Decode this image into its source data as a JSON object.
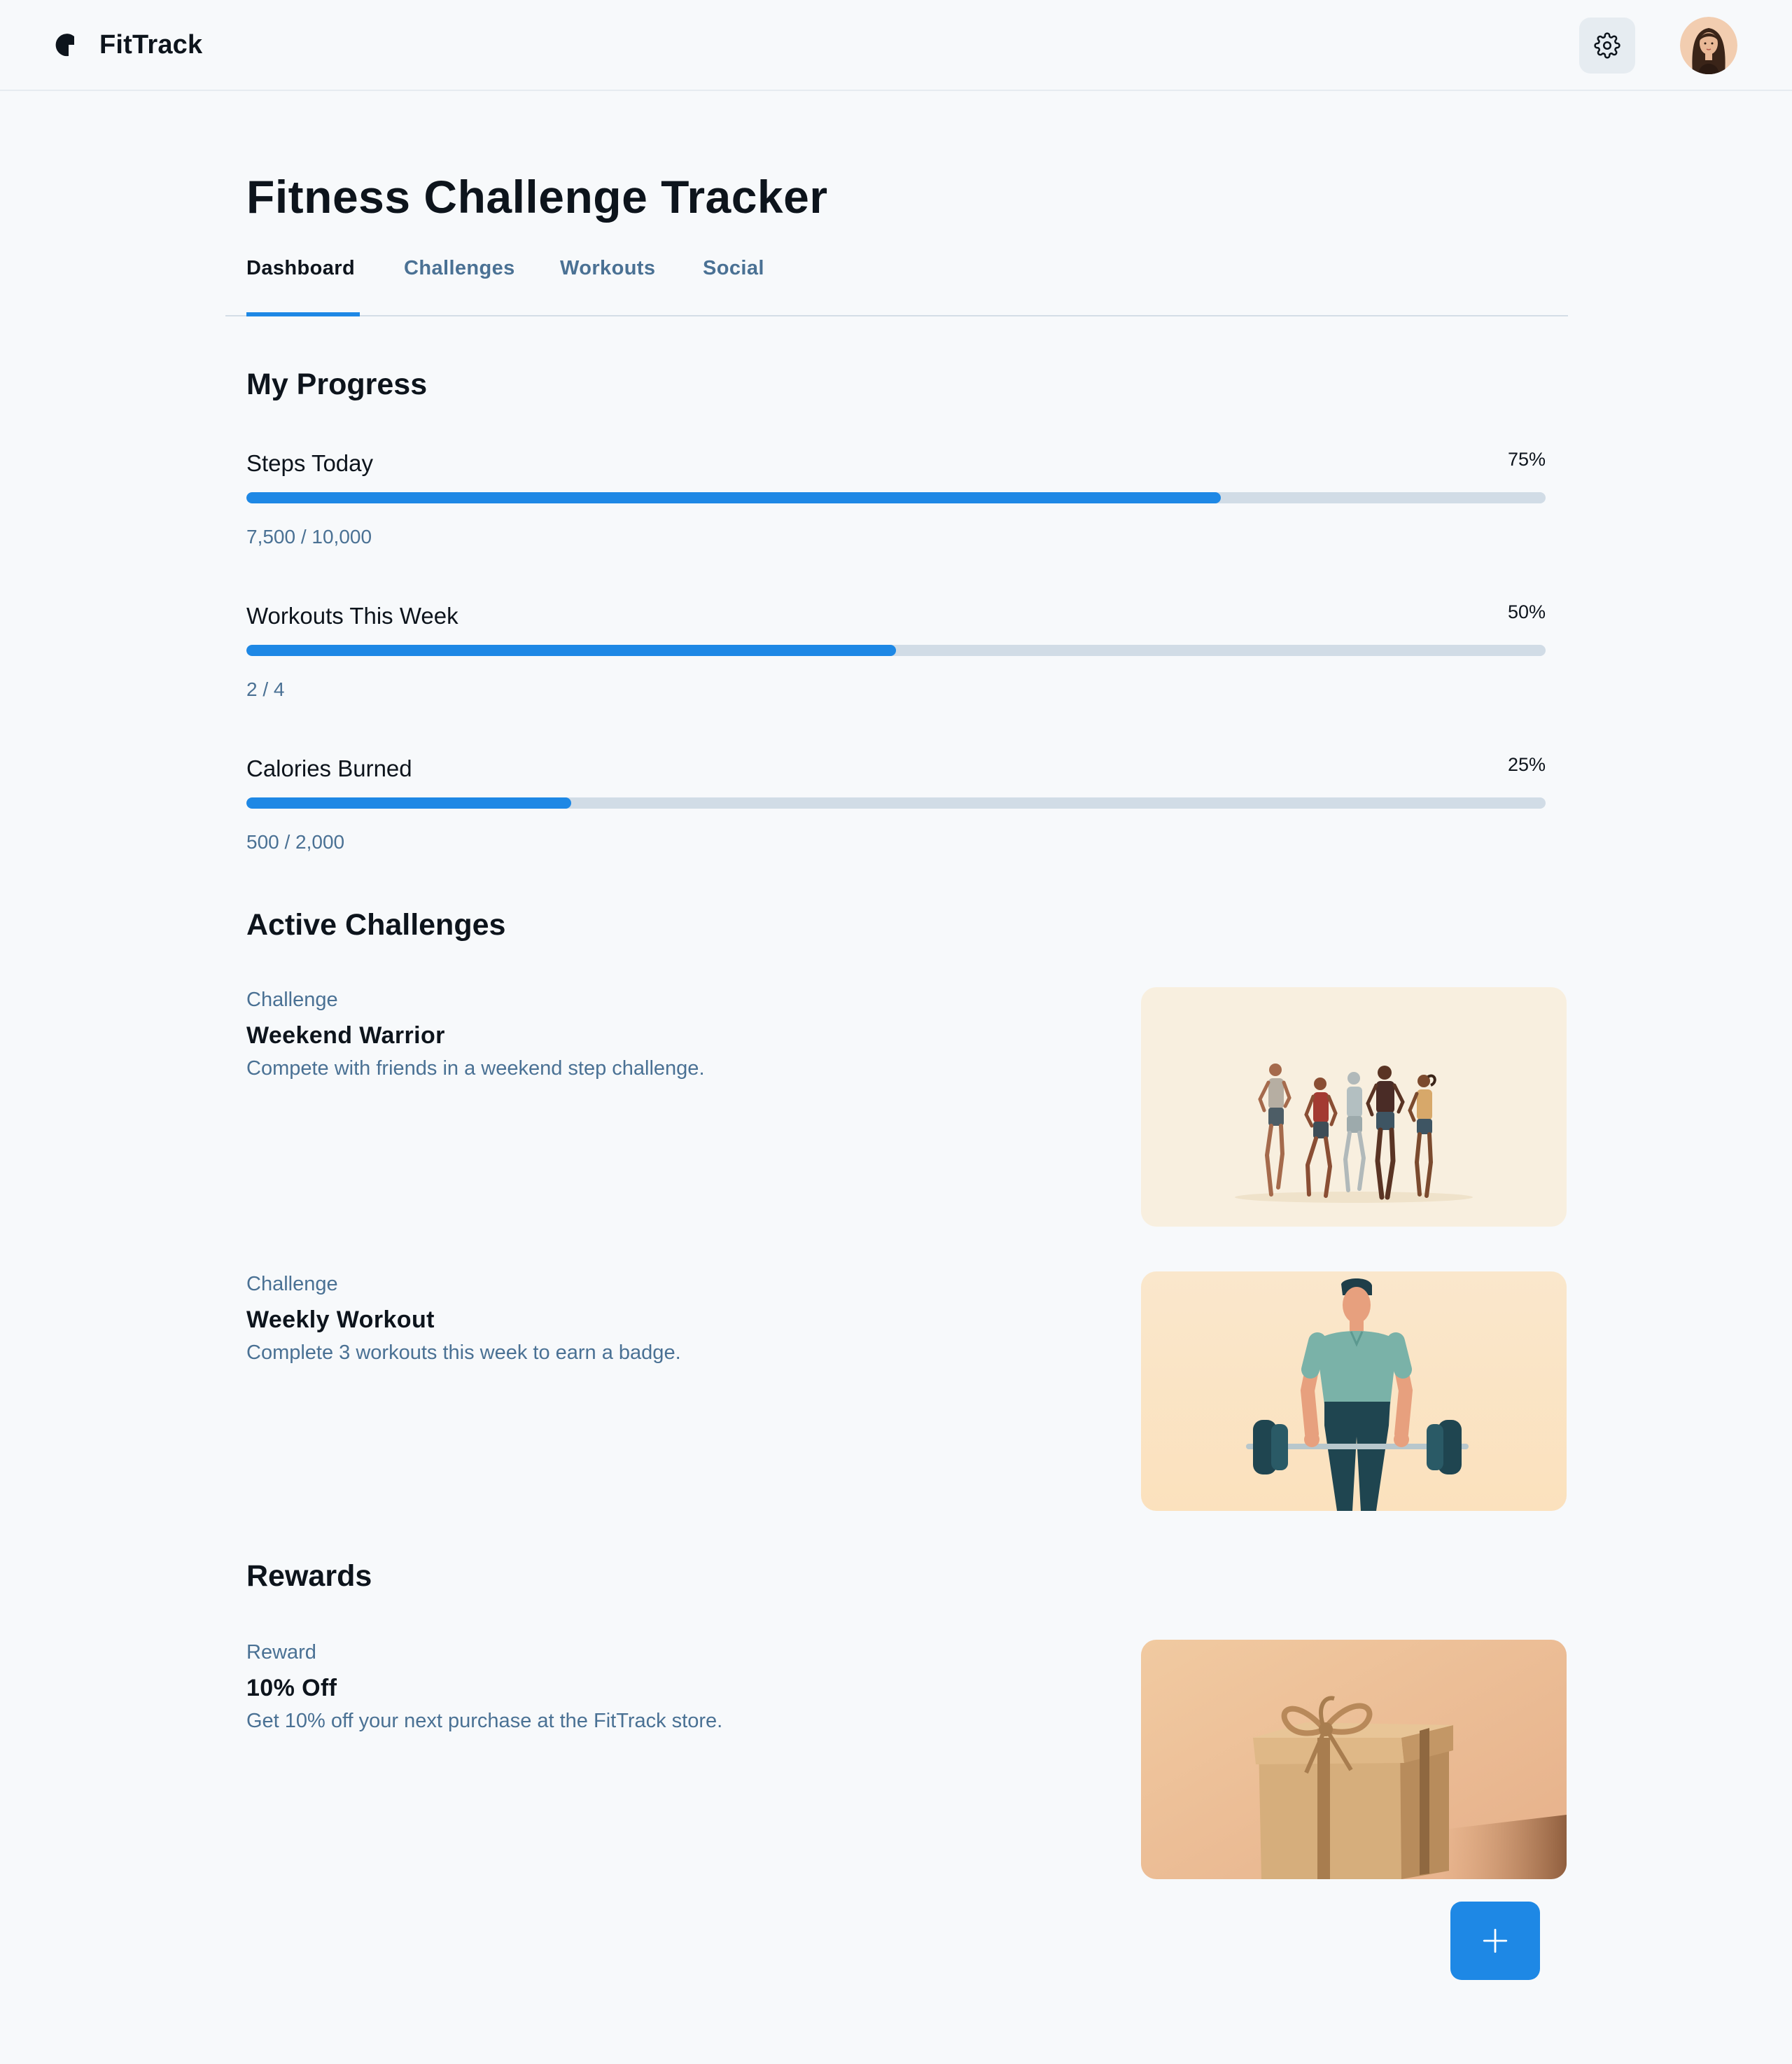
{
  "app": {
    "name": "FitTrack",
    "brand_color": "#1e88e5"
  },
  "header": {
    "settings_icon": "gear-icon",
    "avatar_icon": "user-avatar"
  },
  "page": {
    "title": "Fitness Challenge Tracker"
  },
  "tabs": [
    {
      "label": "Dashboard",
      "active": true
    },
    {
      "label": "Challenges",
      "active": false
    },
    {
      "label": "Workouts",
      "active": false
    },
    {
      "label": "Social",
      "active": false
    }
  ],
  "progress": {
    "title": "My Progress",
    "items": [
      {
        "label": "Steps Today",
        "percent_label": "75%",
        "fill": 0.75,
        "detail": "7,500 / 10,000"
      },
      {
        "label": "Workouts This Week",
        "percent_label": "50%",
        "fill": 0.5,
        "detail": "2 / 4"
      },
      {
        "label": "Calories Burned",
        "percent_label": "25%",
        "fill": 0.25,
        "detail": "500 / 2,000"
      }
    ]
  },
  "challenges": {
    "title": "Active Challenges",
    "items": [
      {
        "kicker": "Challenge",
        "title": "Weekend Warrior",
        "description": "Compete with friends in a weekend step challenge.",
        "image": "group-runners-illustration"
      },
      {
        "kicker": "Challenge",
        "title": "Weekly Workout",
        "description": "Complete 3 workouts this week to earn a badge.",
        "image": "weightlifter-illustration"
      }
    ]
  },
  "rewards": {
    "title": "Rewards",
    "items": [
      {
        "kicker": "Reward",
        "title": "10% Off",
        "description": "Get 10% off your next purchase at the FitTrack store.",
        "image": "gift-box-photo"
      }
    ]
  },
  "fab": {
    "icon": "plus-icon"
  }
}
